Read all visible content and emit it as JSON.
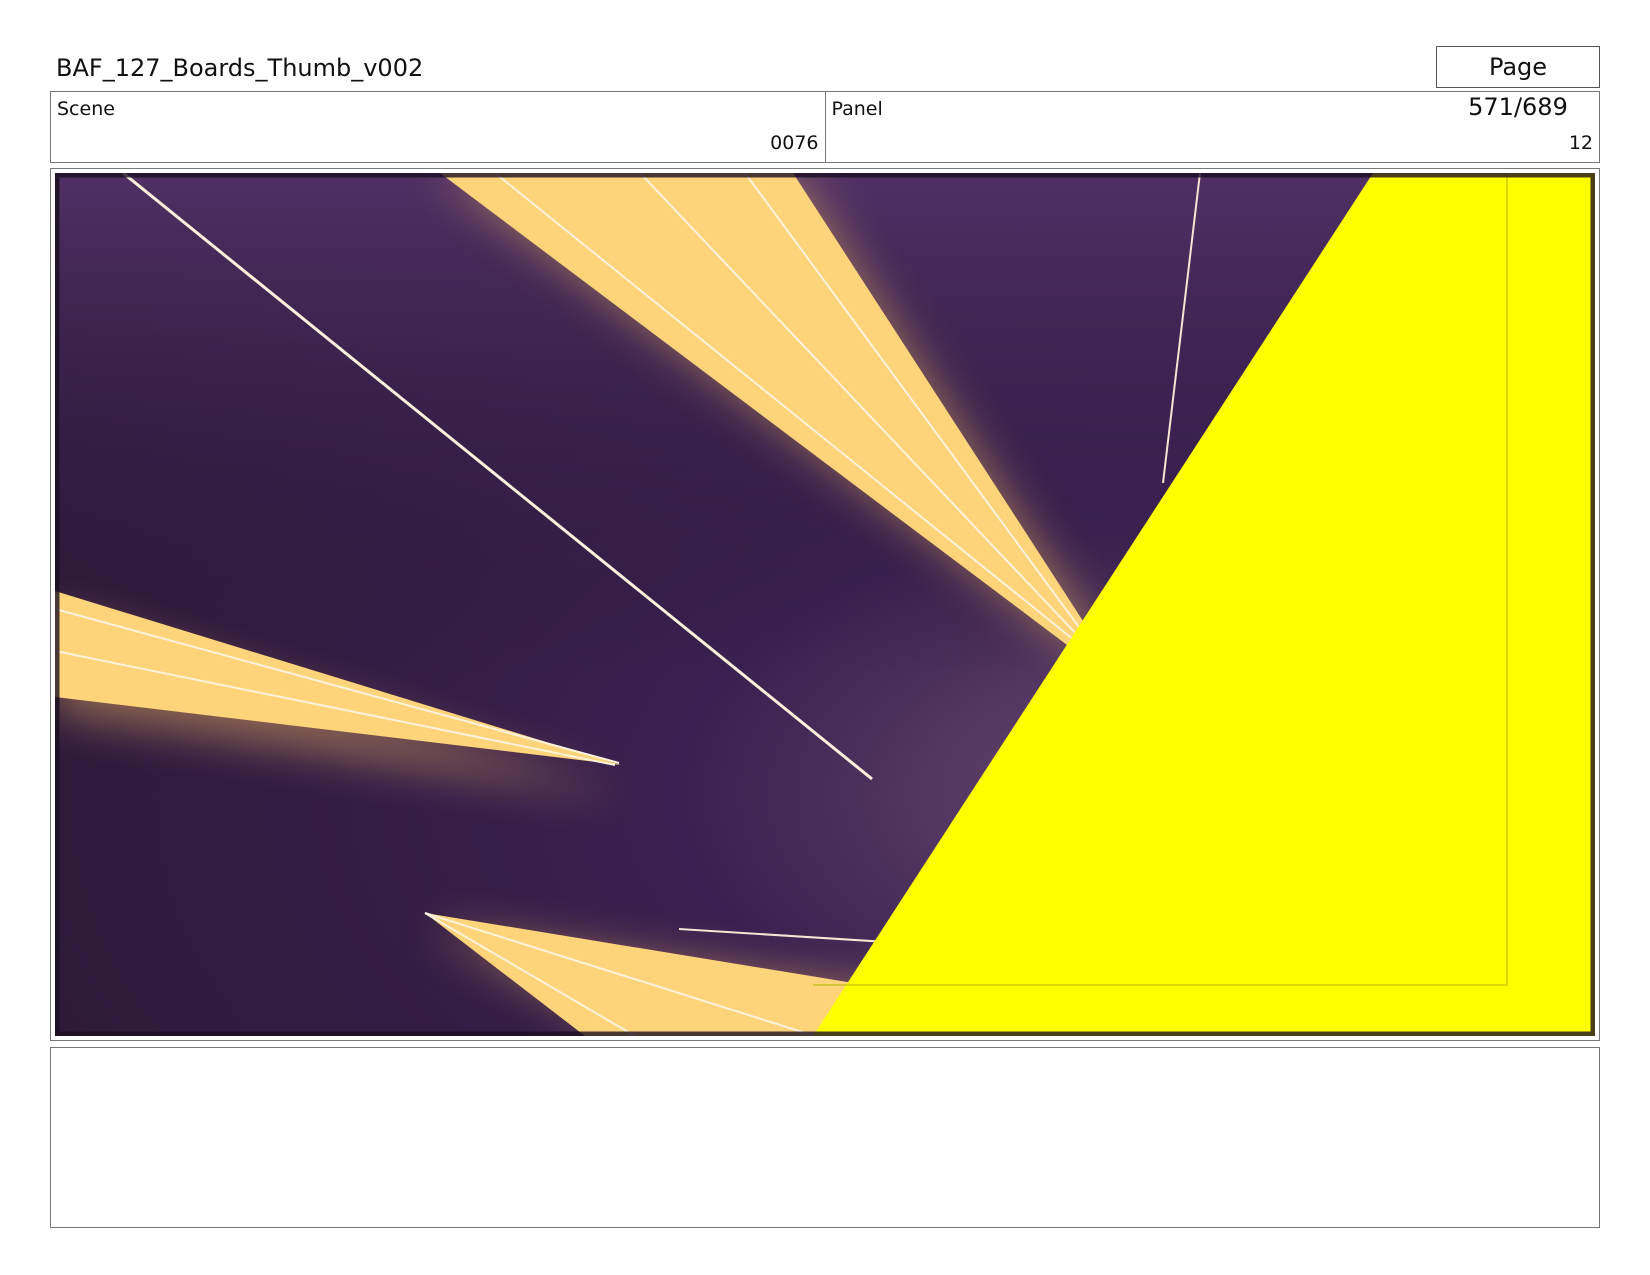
{
  "header": {
    "title": "BAF_127_Boards_Thumb_v002",
    "page": "Page 571/689"
  },
  "info": {
    "scene_label": "Scene",
    "scene_value": "0076",
    "panel_label": "Panel",
    "panel_value": "12"
  },
  "panel_image": {
    "description_icon": "storyboard-panel-image",
    "colors": {
      "background_dark": "#2e1a3e",
      "background_purple": "#4f2f61",
      "beam": "#fdd47a",
      "streak": "#fff2dc",
      "yellow": "#ffff00"
    }
  },
  "notes": {
    "text": ""
  }
}
